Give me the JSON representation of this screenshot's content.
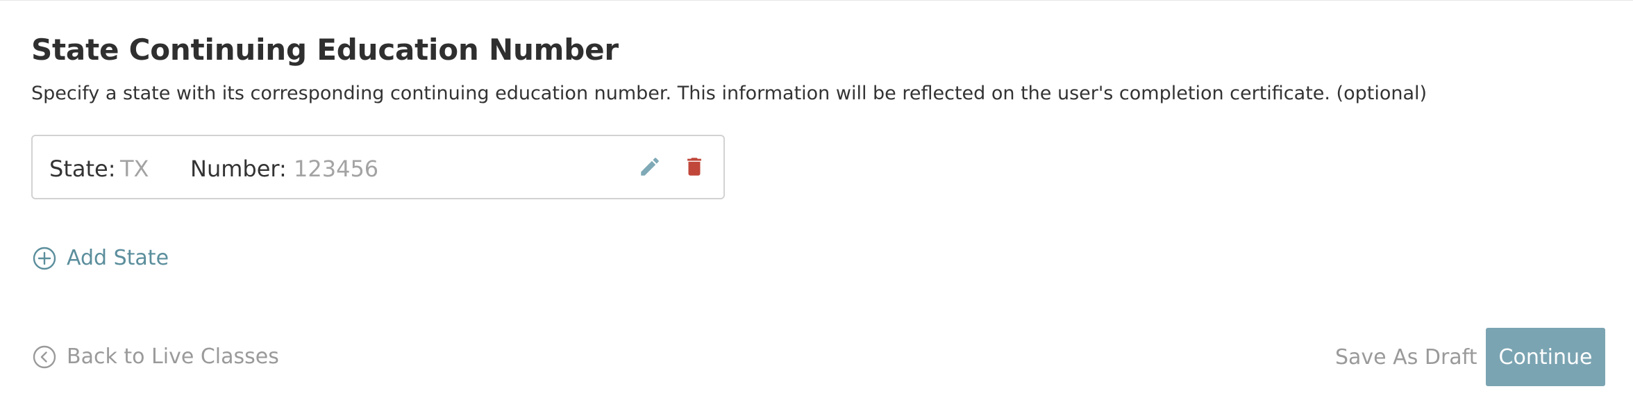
{
  "section": {
    "title": "State Continuing Education Number",
    "description": "Specify a state with its corresponding continuing education number. This information will be reflected on the user's completion certificate. (optional)"
  },
  "entries": [
    {
      "state_label": "State:",
      "state_value": "TX",
      "number_label": "Number:",
      "number_value": "123456",
      "edit_icon": "pencil-icon",
      "delete_icon": "trash-icon"
    }
  ],
  "add_state": {
    "label": "Add State",
    "icon": "plus-circle-icon"
  },
  "footer": {
    "back_label": "Back to Live Classes",
    "back_icon": "chevron-left-circle-icon",
    "save_draft_label": "Save As Draft",
    "continue_label": "Continue"
  },
  "colors": {
    "accent": "#5b8e9c",
    "continue_button": "#7ba4b2",
    "edit_icon": "#7fa9b6",
    "delete_icon": "#c0473a",
    "muted_text": "#9a9a9a"
  }
}
